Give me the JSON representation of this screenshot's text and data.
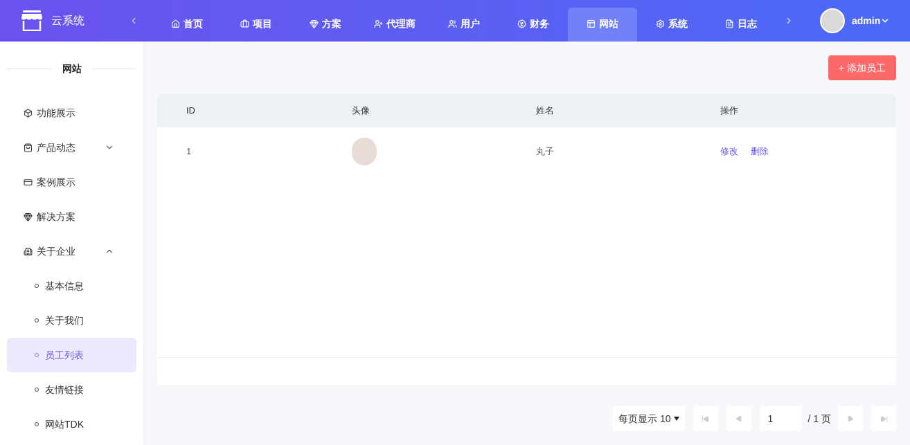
{
  "brand": "云系统",
  "nav": [
    {
      "label": "首页",
      "selected": false
    },
    {
      "label": "项目",
      "selected": false
    },
    {
      "label": "方案",
      "selected": false
    },
    {
      "label": "代理商",
      "selected": false
    },
    {
      "label": "用户",
      "selected": false
    },
    {
      "label": "财务",
      "selected": false
    },
    {
      "label": "网站",
      "selected": true
    },
    {
      "label": "系统",
      "selected": false
    },
    {
      "label": "日志",
      "selected": false
    }
  ],
  "user": {
    "name": "admin"
  },
  "sidebar": {
    "title": "网站",
    "items": [
      {
        "label": "功能展示",
        "kind": "link",
        "selected": false
      },
      {
        "label": "产品动态",
        "kind": "group",
        "expanded": false,
        "selected": false
      },
      {
        "label": "案例展示",
        "kind": "link",
        "selected": false
      },
      {
        "label": "解决方案",
        "kind": "link",
        "selected": false
      },
      {
        "label": "关于企业",
        "kind": "group",
        "expanded": true,
        "selected": false,
        "children": [
          {
            "label": "基本信息",
            "selected": false
          },
          {
            "label": "关于我们",
            "selected": false
          },
          {
            "label": "员工列表",
            "selected": true
          },
          {
            "label": "友情链接",
            "selected": false
          },
          {
            "label": "网站TDK",
            "selected": false
          }
        ]
      }
    ]
  },
  "add_button": "+ 添加员工",
  "table": {
    "columns": [
      "ID",
      "头像",
      "姓名",
      "操作"
    ],
    "rows": [
      {
        "id": "1",
        "name": "丸子",
        "actions": [
          "修改",
          "删除"
        ]
      }
    ]
  },
  "pagination": {
    "page_size": "每页显示 10",
    "page": "1",
    "total": "/ 1 页"
  }
}
